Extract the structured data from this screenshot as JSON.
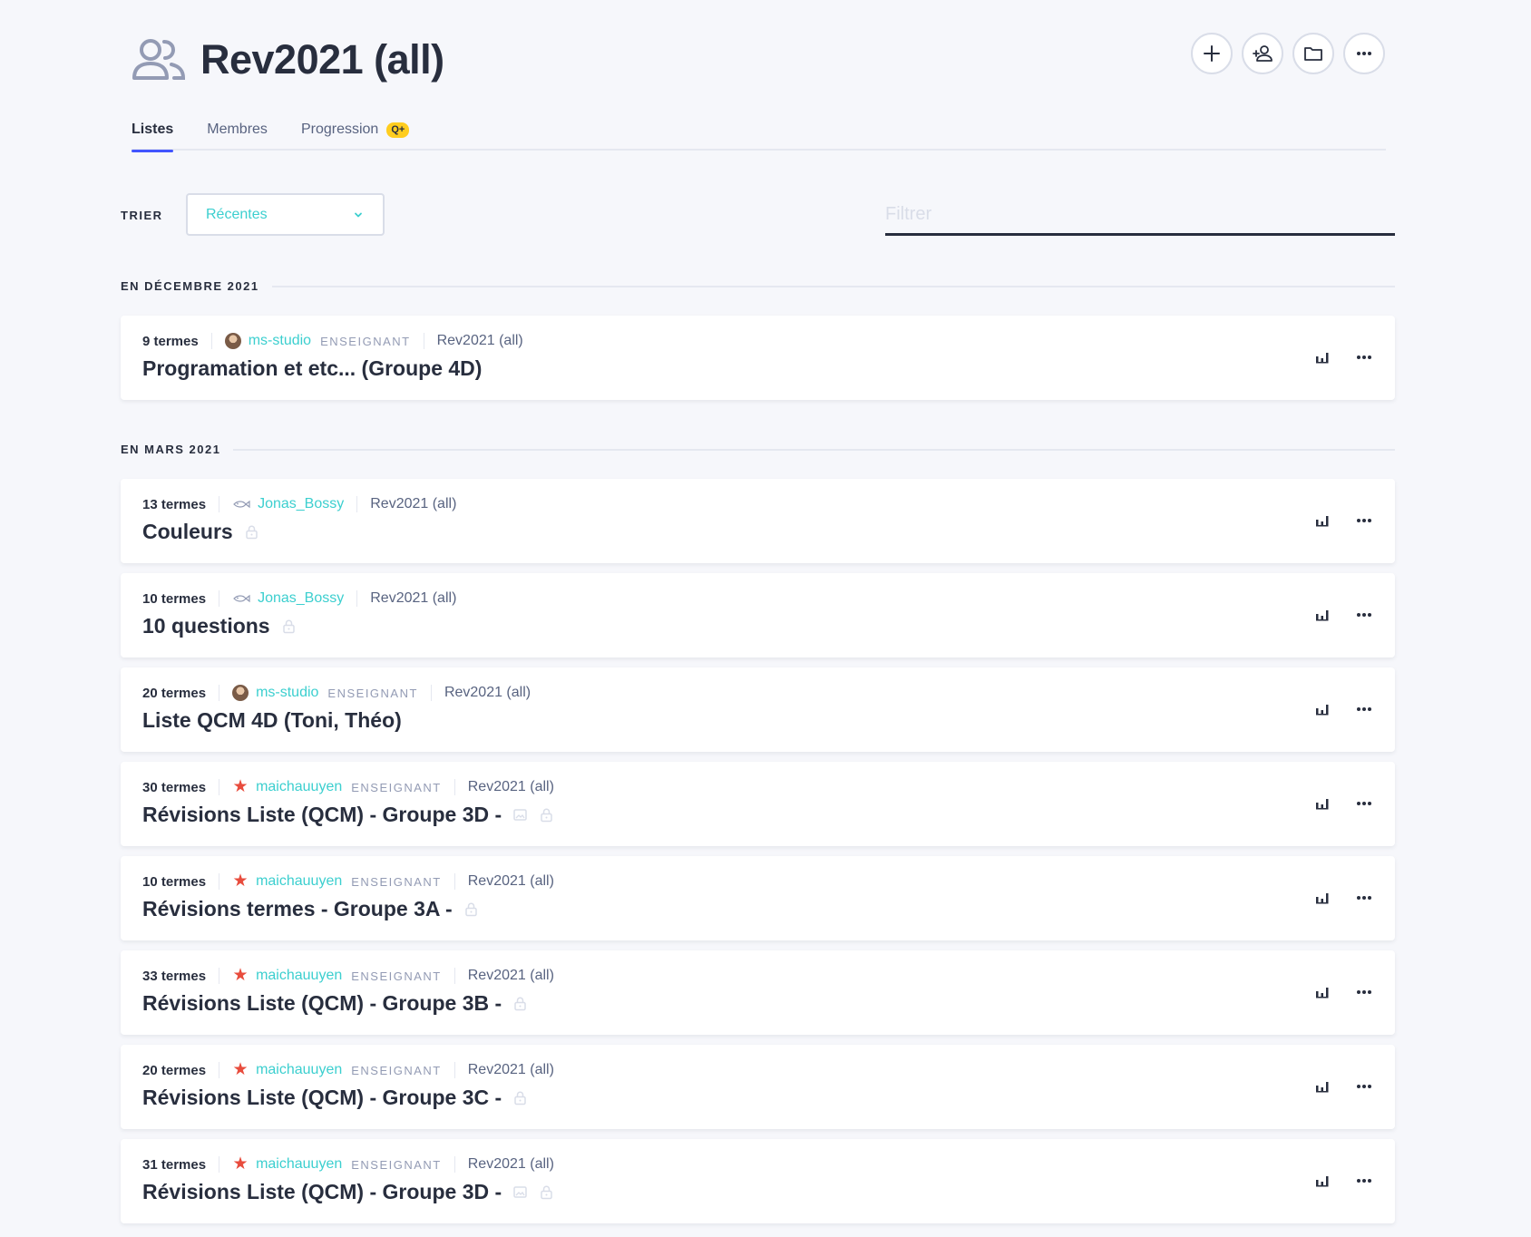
{
  "header": {
    "title": "Rev2021 (all)",
    "icon": "group-icon",
    "actions": [
      {
        "name": "add-button",
        "icon": "plus-icon"
      },
      {
        "name": "add-member-button",
        "icon": "add-user-icon"
      },
      {
        "name": "folder-button",
        "icon": "folder-icon"
      },
      {
        "name": "more-options-button",
        "icon": "ellipsis-icon"
      }
    ]
  },
  "tabs": [
    {
      "label": "Listes",
      "active": true
    },
    {
      "label": "Membres",
      "active": false
    },
    {
      "label": "Progression",
      "active": false,
      "badge": "Q+"
    }
  ],
  "sort": {
    "label": "TRIER",
    "value": "Récentes"
  },
  "filter": {
    "placeholder": "Filtrer",
    "value": ""
  },
  "colors": {
    "accent": "#4255ff",
    "link": "#3ccfcf",
    "text": "#282e3e",
    "muted": "#586380",
    "badge": "#ffcd1f",
    "star": "#e84c3d"
  },
  "sections": [
    {
      "label": "EN DÉCEMBRE 2021",
      "sets": [
        {
          "terms": "9 termes",
          "avatar": "photo",
          "user": "ms-studio",
          "role": "ENSEIGNANT",
          "group": "Rev2021 (all)",
          "title": "Programation et etc... (Groupe 4D)",
          "image": false,
          "locked": false
        }
      ]
    },
    {
      "label": "EN MARS 2021",
      "sets": [
        {
          "terms": "13 termes",
          "avatar": "fish",
          "user": "Jonas_Bossy",
          "role": "",
          "group": "Rev2021 (all)",
          "title": "Couleurs",
          "image": false,
          "locked": true
        },
        {
          "terms": "10 termes",
          "avatar": "fish",
          "user": "Jonas_Bossy",
          "role": "",
          "group": "Rev2021 (all)",
          "title": "10 questions",
          "image": false,
          "locked": true
        },
        {
          "terms": "20 termes",
          "avatar": "photo",
          "user": "ms-studio",
          "role": "ENSEIGNANT",
          "group": "Rev2021 (all)",
          "title": "Liste QCM 4D (Toni, Théo)",
          "image": false,
          "locked": false
        },
        {
          "terms": "30 termes",
          "avatar": "star",
          "user": "maichauuyen",
          "role": "ENSEIGNANT",
          "group": "Rev2021 (all)",
          "title": "Révisions Liste (QCM) - Groupe 3D -",
          "image": true,
          "locked": true
        },
        {
          "terms": "10 termes",
          "avatar": "star",
          "user": "maichauuyen",
          "role": "ENSEIGNANT",
          "group": "Rev2021 (all)",
          "title": "Révisions termes - Groupe 3A -",
          "image": false,
          "locked": true
        },
        {
          "terms": "33 termes",
          "avatar": "star",
          "user": "maichauuyen",
          "role": "ENSEIGNANT",
          "group": "Rev2021 (all)",
          "title": "Révisions Liste (QCM) - Groupe 3B -",
          "image": false,
          "locked": true
        },
        {
          "terms": "20 termes",
          "avatar": "star",
          "user": "maichauuyen",
          "role": "ENSEIGNANT",
          "group": "Rev2021 (all)",
          "title": "Révisions Liste (QCM) - Groupe 3C -",
          "image": false,
          "locked": true
        },
        {
          "terms": "31 termes",
          "avatar": "star",
          "user": "maichauuyen",
          "role": "ENSEIGNANT",
          "group": "Rev2021 (all)",
          "title": "Révisions Liste (QCM) - Groupe 3D -",
          "image": true,
          "locked": true
        }
      ]
    }
  ]
}
